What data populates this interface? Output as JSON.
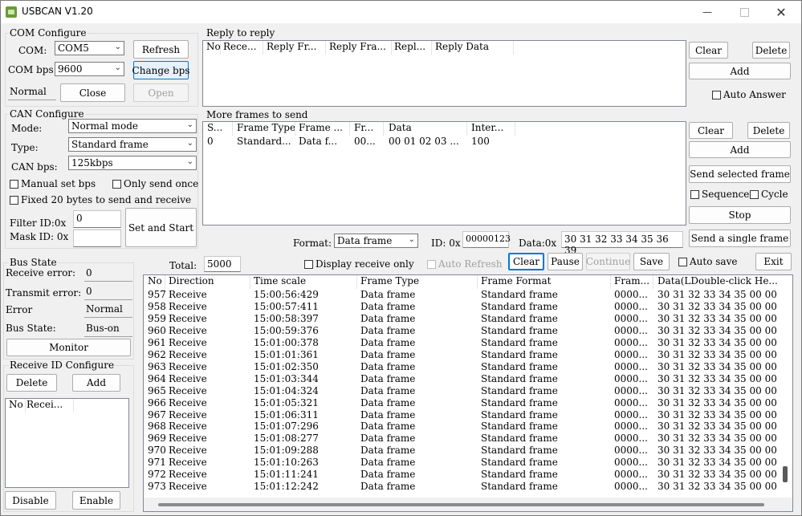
{
  "window": {
    "title": "USBCAN V1.20"
  },
  "com": {
    "group_label": "COM Configure",
    "com_label": "COM:",
    "com_value": "COM5",
    "bps_label": "COM bps:",
    "bps_value": "9600",
    "status": "Normal",
    "refresh": "Refresh",
    "change_bps": "Change bps",
    "close": "Close",
    "open": "Open"
  },
  "can": {
    "group_label": "CAN Configure",
    "mode_label": "Mode:",
    "mode_value": "Normal mode",
    "type_label": "Type:",
    "type_value": "Standard frame",
    "bps_label": "CAN bps:",
    "bps_value": "125kbps",
    "manual_bps": "Manual set bps",
    "send_once": "Only send once",
    "fixed20": "Fixed 20 bytes to send and receive",
    "filter_label": "Filter ID:0x",
    "filter_value": "0",
    "mask_label": "Mask ID:  0x",
    "mask_value": "",
    "set_start": "Set and Start"
  },
  "bus": {
    "group_label": "Bus State",
    "rx_err_label": "Receive error:",
    "rx_err": "0",
    "tx_err_label": "Transmit error:",
    "tx_err": "0",
    "error_label": "Error",
    "error": "Normal",
    "state_label": "Bus State:",
    "state": "Bus-on",
    "monitor": "Monitor"
  },
  "recv_id": {
    "group_label": "Receive ID Configure",
    "delete": "Delete",
    "add": "Add",
    "headers": [
      "No",
      "Recei..."
    ],
    "disable": "Disable",
    "enable": "Enable"
  },
  "reply": {
    "group_label": "Reply to reply",
    "headers": [
      "No",
      "Rece...",
      "Reply Fr...",
      "Reply Fra...",
      "Repl...",
      "Reply Data"
    ],
    "clear": "Clear",
    "delete": "Delete",
    "add": "Add",
    "auto_answer": "Auto Answer"
  },
  "more": {
    "group_label": "More frames to send",
    "headers": [
      "S...",
      "Frame Type",
      "Frame ...",
      "Fr...",
      "Data",
      "Inter..."
    ],
    "row": [
      "0",
      "Standard...",
      "Data f...",
      "00...",
      "00 01 02 03 ...",
      "100"
    ],
    "clear": "Clear",
    "delete": "Delete",
    "add": "Add",
    "send_selected": "Send selected frame",
    "sequence": "Sequence",
    "cycle": "Cycle",
    "stop": "Stop"
  },
  "send": {
    "format_label": "Format:",
    "format_value": "Data frame",
    "id_label": "ID: 0x",
    "id_value": "00000123",
    "data_label": "Data:0x",
    "data_value": "30 31 32 33 34 35 36 39",
    "send_single": "Send a single frame"
  },
  "recv": {
    "total_label": "Total:",
    "total_value": "5000",
    "display_only": "Display receive only",
    "auto_refresh": "Auto Refresh",
    "clear": "Clear",
    "pause": "Pause",
    "continue": "Continue",
    "save": "Save",
    "auto_save": "Auto save",
    "exit": "Exit",
    "headers": [
      "No",
      "Direction",
      "Time scale",
      "Frame Type",
      "Frame Format",
      "Fram...",
      "Data(LDouble-click He..."
    ],
    "rows": [
      [
        "957",
        "Receive",
        "15:00:56:429",
        "Data frame",
        "Standard frame",
        "0000...",
        "30 31 32 33 34 35 00 00"
      ],
      [
        "958",
        "Receive",
        "15:00:57:411",
        "Data frame",
        "Standard frame",
        "0000...",
        "30 31 32 33 34 35 00 00"
      ],
      [
        "959",
        "Receive",
        "15:00:58:397",
        "Data frame",
        "Standard frame",
        "0000...",
        "30 31 32 33 34 35 00 00"
      ],
      [
        "960",
        "Receive",
        "15:00:59:376",
        "Data frame",
        "Standard frame",
        "0000...",
        "30 31 32 33 34 35 00 00"
      ],
      [
        "961",
        "Receive",
        "15:01:00:378",
        "Data frame",
        "Standard frame",
        "0000...",
        "30 31 32 33 34 35 00 00"
      ],
      [
        "962",
        "Receive",
        "15:01:01:361",
        "Data frame",
        "Standard frame",
        "0000...",
        "30 31 32 33 34 35 00 00"
      ],
      [
        "963",
        "Receive",
        "15:01:02:350",
        "Data frame",
        "Standard frame",
        "0000...",
        "30 31 32 33 34 35 00 00"
      ],
      [
        "964",
        "Receive",
        "15:01:03:344",
        "Data frame",
        "Standard frame",
        "0000...",
        "30 31 32 33 34 35 00 00"
      ],
      [
        "965",
        "Receive",
        "15:01:04:324",
        "Data frame",
        "Standard frame",
        "0000...",
        "30 31 32 33 34 35 00 00"
      ],
      [
        "966",
        "Receive",
        "15:01:05:321",
        "Data frame",
        "Standard frame",
        "0000...",
        "30 31 32 33 34 35 00 00"
      ],
      [
        "967",
        "Receive",
        "15:01:06:311",
        "Data frame",
        "Standard frame",
        "0000...",
        "30 31 32 33 34 35 00 00"
      ],
      [
        "968",
        "Receive",
        "15:01:07:296",
        "Data frame",
        "Standard frame",
        "0000...",
        "30 31 32 33 34 35 00 00"
      ],
      [
        "969",
        "Receive",
        "15:01:08:277",
        "Data frame",
        "Standard frame",
        "0000...",
        "30 31 32 33 34 35 00 00"
      ],
      [
        "970",
        "Receive",
        "15:01:09:288",
        "Data frame",
        "Standard frame",
        "0000...",
        "30 31 32 33 34 35 00 00"
      ],
      [
        "971",
        "Receive",
        "15:01:10:263",
        "Data frame",
        "Standard frame",
        "0000...",
        "30 31 32 33 34 35 00 00"
      ],
      [
        "972",
        "Receive",
        "15:01:11:241",
        "Data frame",
        "Standard frame",
        "0000...",
        "30 31 32 33 34 35 00 00"
      ],
      [
        "973",
        "Receive",
        "15:01:12:242",
        "Data frame",
        "Standard frame",
        "0000...",
        "30 31 32 33 34 35 00 00"
      ]
    ]
  },
  "colors": {
    "accent": "#0078d7",
    "window_bg": "#f0f0f0",
    "list_bg": "#ffffff"
  },
  "icons": {
    "app": "usbcan-app-icon",
    "minimize": "minimize-icon",
    "maximize": "maximize-icon",
    "close": "close-icon"
  }
}
